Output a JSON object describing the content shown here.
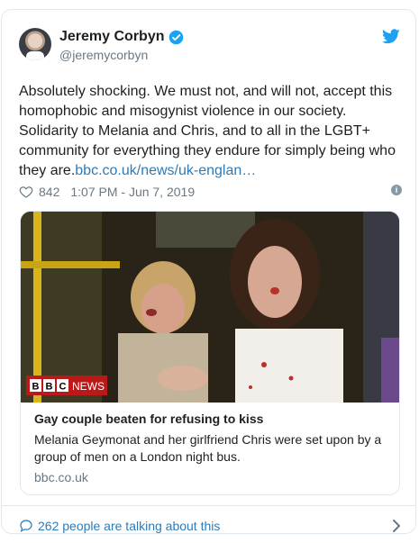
{
  "author": {
    "name": "Jeremy Corbyn",
    "handle": "@jeremycorbyn"
  },
  "tweet": {
    "text": "Absolutely shocking. We must not, and will not, accept this homophobic and misogynist violence in our society. Solidarity to Melania and Chris, and to all in the LGBT+ community for everything they endure for simply being who they are.",
    "link": "bbc.co.uk/news/uk-englan…"
  },
  "meta": {
    "likes": "842",
    "timestamp": "1:07 PM - Jun 7, 2019",
    "info": "i"
  },
  "card": {
    "title": "Gay couple beaten for refusing to kiss",
    "description": "Melania Geymonat and her girlfriend Chris were set upon by a group of men on a London night bus.",
    "domain": "bbc.co.uk",
    "logo_letters": [
      "B",
      "B",
      "C"
    ],
    "logo_suffix": "NEWS"
  },
  "footer": {
    "talking": "262 people are talking about this"
  },
  "colors": {
    "link": "#2b7bb9",
    "verified": "#1da1f2",
    "bbc_red": "#bb1919"
  },
  "icons": [
    "verified-badge-icon",
    "twitter-bird-icon",
    "heart-icon",
    "info-icon",
    "comment-bubble-icon",
    "chevron-right-icon"
  ]
}
